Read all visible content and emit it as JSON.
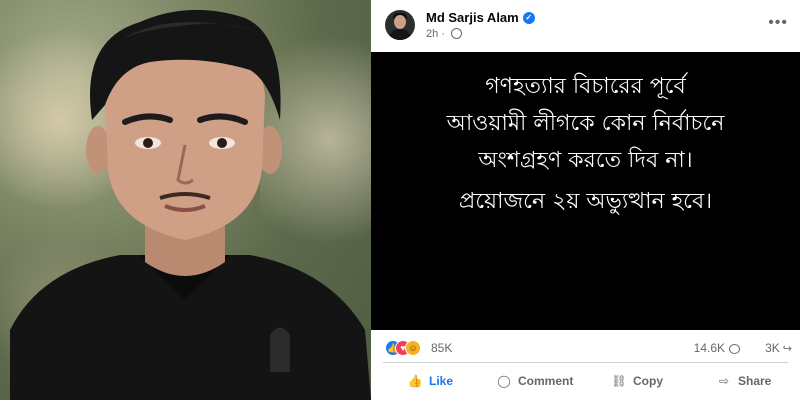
{
  "post": {
    "author": "Md Sarjis Alam",
    "time": "2h",
    "text_lines": [
      "গণহত্যার বিচারের পূর্বে",
      "আওয়ামী লীগকে কোন নির্বাচনে",
      "অংশগ্রহণ করতে দিব না।",
      "প্রয়োজনে ২য় অভ্যুত্থান হবে।"
    ],
    "reactions_count": "85K",
    "comments_count": "14.6K",
    "shares_count": "3K"
  },
  "actions": {
    "like": "Like",
    "comment": "Comment",
    "copy": "Copy",
    "share": "Share"
  },
  "icons": {
    "verified": "verified-badge-icon",
    "globe": "globe-icon",
    "more": "more-options-icon",
    "like": "thumbs-up-icon",
    "comment": "comment-bubble-icon",
    "copy": "copy-link-icon",
    "share": "share-arrow-icon"
  },
  "colors": {
    "accent": "#1877f2",
    "post_background": "#000000",
    "post_text": "#ffffff",
    "secondary_text": "#65676b"
  }
}
